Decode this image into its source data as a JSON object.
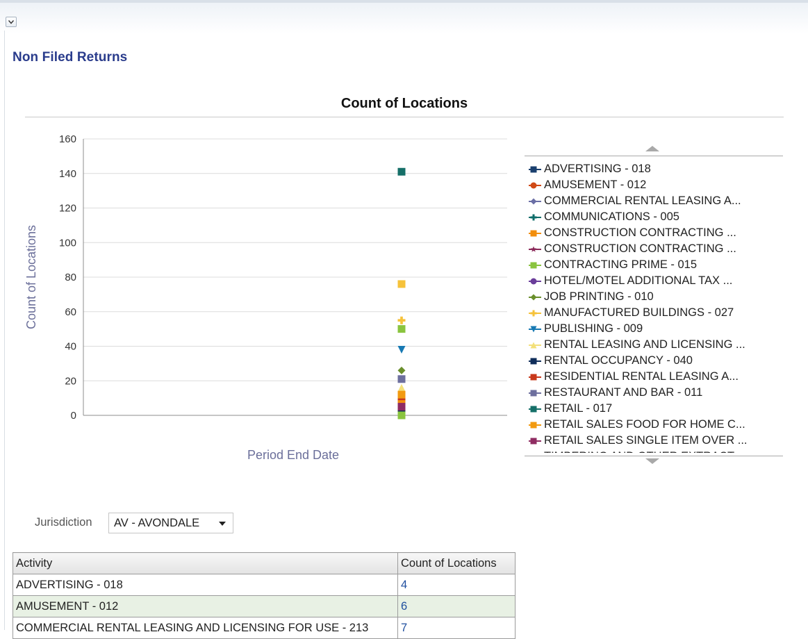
{
  "page": {
    "title": "Non Filed Returns"
  },
  "chart": {
    "title": "Count of Locations",
    "x_label": "Period End Date",
    "y_label": "Count of Locations"
  },
  "chart_data": {
    "type": "scatter",
    "title": "Count of Locations",
    "xlabel": "Period End Date",
    "ylabel": "Count of Locations",
    "ylim": [
      0,
      160
    ],
    "yticks": [
      0,
      20,
      40,
      60,
      80,
      100,
      120,
      140,
      160
    ],
    "grid": true,
    "legend_placement": "right",
    "series": [
      {
        "name": "ADVERTISING - 018",
        "color": "#1a3f6e",
        "marker": "square",
        "values": [
          4
        ]
      },
      {
        "name": "AMUSEMENT - 012",
        "color": "#d04a16",
        "marker": "circle",
        "values": [
          6
        ]
      },
      {
        "name": "COMMERCIAL RENTAL LEASING A...",
        "color": "#6b6fa6",
        "marker": "diamond",
        "values": [
          7
        ]
      },
      {
        "name": "COMMUNICATIONS - 005",
        "color": "#0f6d6a",
        "marker": "plus",
        "values": [
          2
        ]
      },
      {
        "name": "CONSTRUCTION CONTRACTING  ...",
        "color": "#f28e0c",
        "marker": "square",
        "values": [
          9
        ]
      },
      {
        "name": "CONSTRUCTION CONTRACTING  ...",
        "color": "#8b2a5a",
        "marker": "star",
        "values": [
          3
        ]
      },
      {
        "name": "CONTRACTING  PRIME - 015",
        "color": "#8ac43f",
        "marker": "square",
        "values": [
          50
        ]
      },
      {
        "name": "HOTEL/MOTEL ADDITIONAL TAX ...",
        "color": "#6a3d9a",
        "marker": "circle",
        "values": [
          1
        ]
      },
      {
        "name": "JOB PRINTING - 010",
        "color": "#6a8f2c",
        "marker": "diamond",
        "values": [
          26
        ]
      },
      {
        "name": "MANUFACTURED BUILDINGS - 027",
        "color": "#f6c23a",
        "marker": "plus",
        "values": [
          55
        ]
      },
      {
        "name": "PUBLISHING - 009",
        "color": "#1779b3",
        "marker": "triangle-down",
        "values": [
          38
        ]
      },
      {
        "name": "RENTAL LEASING AND LICENSING ...",
        "color": "#f3e07a",
        "marker": "triangle-up",
        "values": [
          16
        ]
      },
      {
        "name": "RENTAL OCCUPANCY - 040",
        "color": "#0f2d5a",
        "marker": "square",
        "values": [
          1
        ]
      },
      {
        "name": "RESIDENTIAL RENTAL LEASING A...",
        "color": "#c8381b",
        "marker": "square",
        "values": [
          11
        ]
      },
      {
        "name": "RESTAURANT AND BAR - 011",
        "color": "#6d6f9e",
        "marker": "square",
        "values": [
          21
        ]
      },
      {
        "name": "RETAIL - 017",
        "color": "#156f68",
        "marker": "square",
        "values": [
          141
        ]
      },
      {
        "name": "RETAIL SALES FOOD FOR HOME C...",
        "color": "#f29a10",
        "marker": "square",
        "values": [
          12
        ]
      },
      {
        "name": "RETAIL SALES SINGLE ITEM OVER ...",
        "color": "#8f2c62",
        "marker": "square",
        "values": [
          5
        ]
      },
      {
        "name": "TIMBERING AND OTHER EXTRACT...",
        "color": "#8ac43f",
        "marker": "square",
        "values": [
          0
        ]
      },
      {
        "name": "",
        "color": "#f6c23a",
        "marker": "square",
        "values": [
          76
        ]
      }
    ]
  },
  "legend": {
    "items": [
      {
        "label": "ADVERTISING - 018",
        "color": "#1a3f6e",
        "marker": "square"
      },
      {
        "label": "AMUSEMENT - 012",
        "color": "#d04a16",
        "marker": "circle"
      },
      {
        "label": "COMMERCIAL RENTAL LEASING A...",
        "color": "#6b6fa6",
        "marker": "diamond"
      },
      {
        "label": "COMMUNICATIONS - 005",
        "color": "#0f6d6a",
        "marker": "plus"
      },
      {
        "label": "CONSTRUCTION CONTRACTING  ...",
        "color": "#f28e0c",
        "marker": "square"
      },
      {
        "label": "CONSTRUCTION CONTRACTING  ...",
        "color": "#8b2a5a",
        "marker": "star"
      },
      {
        "label": "CONTRACTING  PRIME - 015",
        "color": "#8ac43f",
        "marker": "square"
      },
      {
        "label": "HOTEL/MOTEL ADDITIONAL TAX ...",
        "color": "#6a3d9a",
        "marker": "circle"
      },
      {
        "label": "JOB PRINTING - 010",
        "color": "#6a8f2c",
        "marker": "diamond"
      },
      {
        "label": "MANUFACTURED BUILDINGS - 027",
        "color": "#f6c23a",
        "marker": "plus"
      },
      {
        "label": "PUBLISHING - 009",
        "color": "#1779b3",
        "marker": "triangle-down"
      },
      {
        "label": "RENTAL LEASING AND LICENSING ...",
        "color": "#f3e07a",
        "marker": "triangle-up"
      },
      {
        "label": "RENTAL OCCUPANCY - 040",
        "color": "#0f2d5a",
        "marker": "square"
      },
      {
        "label": "RESIDENTIAL RENTAL LEASING A...",
        "color": "#c8381b",
        "marker": "square"
      },
      {
        "label": "RESTAURANT AND BAR - 011",
        "color": "#6d6f9e",
        "marker": "square"
      },
      {
        "label": "RETAIL - 017",
        "color": "#156f68",
        "marker": "square"
      },
      {
        "label": "RETAIL SALES FOOD FOR HOME C...",
        "color": "#f29a10",
        "marker": "square"
      },
      {
        "label": "RETAIL SALES SINGLE ITEM OVER ...",
        "color": "#8f2c62",
        "marker": "square"
      },
      {
        "label": "TIMBERING AND OTHER EXTRACT...",
        "color": "#8ac43f",
        "marker": "square"
      }
    ]
  },
  "filter": {
    "label": "Jurisdiction",
    "selected": "AV - AVONDALE"
  },
  "table": {
    "headers": [
      "Activity",
      "Count of Locations"
    ],
    "rows": [
      {
        "activity": "ADVERTISING - 018",
        "count": "4"
      },
      {
        "activity": "AMUSEMENT - 012",
        "count": "6"
      },
      {
        "activity": "COMMERCIAL RENTAL LEASING AND LICENSING FOR USE - 213",
        "count": "7"
      }
    ]
  }
}
